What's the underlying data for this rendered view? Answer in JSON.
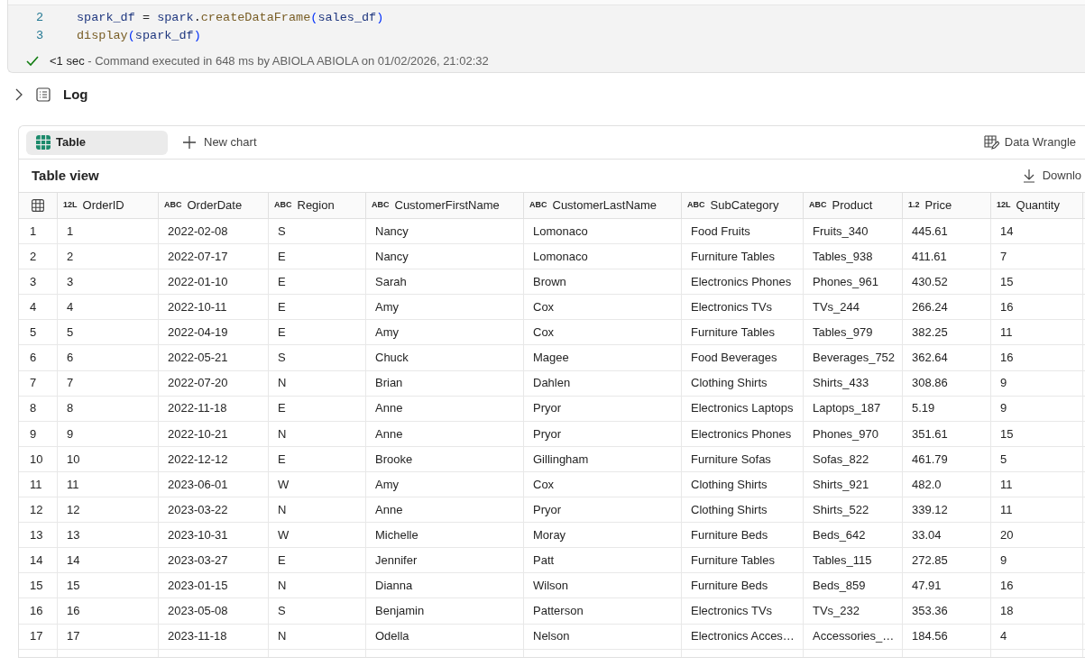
{
  "code_cell": {
    "lines": [
      {
        "number": "2",
        "tokens": [
          {
            "kind": "var",
            "text": "spark_df"
          },
          {
            "kind": "op",
            "text": " = "
          },
          {
            "kind": "var",
            "text": "spark"
          },
          {
            "kind": "op",
            "text": "."
          },
          {
            "kind": "func",
            "text": "createDataFrame"
          },
          {
            "kind": "paren",
            "text": "("
          },
          {
            "kind": "var",
            "text": "sales_df"
          },
          {
            "kind": "paren",
            "text": ")"
          }
        ]
      },
      {
        "number": "3",
        "tokens": [
          {
            "kind": "func",
            "text": "display"
          },
          {
            "kind": "paren",
            "text": "("
          },
          {
            "kind": "var",
            "text": "spark_df"
          },
          {
            "kind": "paren",
            "text": ")"
          }
        ]
      }
    ],
    "status": {
      "duration": "<1 sec",
      "message": " - Command executed in 648 ms by ABIOLA ABIOLA on 01/02/2026, 21:02:32"
    }
  },
  "log": {
    "label": "Log",
    "expanded": false
  },
  "output": {
    "tabs": [
      {
        "label": "Table",
        "selected": true
      }
    ],
    "new_chart": "New chart",
    "data_wrangler": "Data Wrangle",
    "title": "Table view",
    "download": "Downlo",
    "columns": [
      {
        "type_tag": "12L",
        "name": "OrderID"
      },
      {
        "type_tag": "ABC",
        "name": "OrderDate"
      },
      {
        "type_tag": "ABC",
        "name": "Region"
      },
      {
        "type_tag": "ABC",
        "name": "CustomerFirstName"
      },
      {
        "type_tag": "ABC",
        "name": "CustomerLastName"
      },
      {
        "type_tag": "ABC",
        "name": "SubCategory"
      },
      {
        "type_tag": "ABC",
        "name": "Product"
      },
      {
        "type_tag": "1.2",
        "name": "Price"
      },
      {
        "type_tag": "12L",
        "name": "Quantity"
      }
    ],
    "rows": [
      {
        "index": "1",
        "cells": [
          "1",
          "2022-02-08",
          "S",
          "Nancy",
          "Lomonaco",
          "Food Fruits",
          "Fruits_340",
          "445.61",
          "14"
        ]
      },
      {
        "index": "2",
        "cells": [
          "2",
          "2022-07-17",
          "E",
          "Nancy",
          "Lomonaco",
          "Furniture Tables",
          "Tables_938",
          "411.61",
          "7"
        ]
      },
      {
        "index": "3",
        "cells": [
          "3",
          "2022-01-10",
          "E",
          "Sarah",
          "Brown",
          "Electronics Phones",
          "Phones_961",
          "430.52",
          "15"
        ]
      },
      {
        "index": "4",
        "cells": [
          "4",
          "2022-10-11",
          "E",
          "Amy",
          "Cox",
          "Electronics TVs",
          "TVs_244",
          "266.24",
          "16"
        ]
      },
      {
        "index": "5",
        "cells": [
          "5",
          "2022-04-19",
          "E",
          "Amy",
          "Cox",
          "Furniture Tables",
          "Tables_979",
          "382.25",
          "11"
        ]
      },
      {
        "index": "6",
        "cells": [
          "6",
          "2022-05-21",
          "S",
          "Chuck",
          "Magee",
          "Food Beverages",
          "Beverages_752",
          "362.64",
          "16"
        ]
      },
      {
        "index": "7",
        "cells": [
          "7",
          "2022-07-20",
          "N",
          "Brian",
          "Dahlen",
          "Clothing Shirts",
          "Shirts_433",
          "308.86",
          "9"
        ]
      },
      {
        "index": "8",
        "cells": [
          "8",
          "2022-11-18",
          "E",
          "Anne",
          "Pryor",
          "Electronics Laptops",
          "Laptops_187",
          "5.19",
          "9"
        ]
      },
      {
        "index": "9",
        "cells": [
          "9",
          "2022-10-21",
          "N",
          "Anne",
          "Pryor",
          "Electronics Phones",
          "Phones_970",
          "351.61",
          "15"
        ]
      },
      {
        "index": "10",
        "cells": [
          "10",
          "2022-12-12",
          "E",
          "Brooke",
          "Gillingham",
          "Furniture Sofas",
          "Sofas_822",
          "461.79",
          "5"
        ]
      },
      {
        "index": "11",
        "cells": [
          "11",
          "2023-06-01",
          "W",
          "Amy",
          "Cox",
          "Clothing Shirts",
          "Shirts_921",
          "482.0",
          "11"
        ]
      },
      {
        "index": "12",
        "cells": [
          "12",
          "2023-03-22",
          "N",
          "Anne",
          "Pryor",
          "Clothing Shirts",
          "Shirts_522",
          "339.12",
          "11"
        ]
      },
      {
        "index": "13",
        "cells": [
          "13",
          "2023-10-31",
          "W",
          "Michelle",
          "Moray",
          "Furniture Beds",
          "Beds_642",
          "33.04",
          "20"
        ]
      },
      {
        "index": "14",
        "cells": [
          "14",
          "2023-03-27",
          "E",
          "Jennifer",
          "Patt",
          "Furniture Tables",
          "Tables_115",
          "272.85",
          "9"
        ]
      },
      {
        "index": "15",
        "cells": [
          "15",
          "2023-01-15",
          "N",
          "Dianna",
          "Wilson",
          "Furniture Beds",
          "Beds_859",
          "47.91",
          "16"
        ]
      },
      {
        "index": "16",
        "cells": [
          "16",
          "2023-05-08",
          "S",
          "Benjamin",
          "Patterson",
          "Electronics TVs",
          "TVs_232",
          "353.36",
          "18"
        ]
      },
      {
        "index": "17",
        "cells": [
          "17",
          "2023-11-18",
          "N",
          "Odella",
          "Nelson",
          "Electronics Acces…",
          "Accessories_…",
          "184.56",
          "4"
        ]
      }
    ]
  }
}
